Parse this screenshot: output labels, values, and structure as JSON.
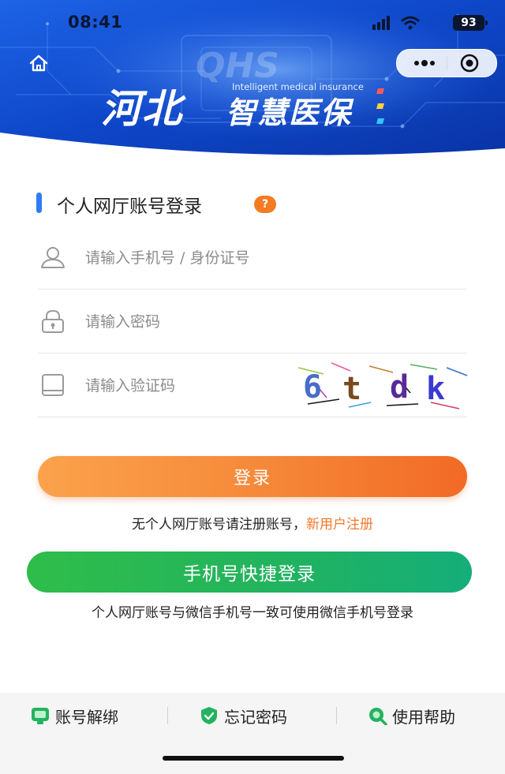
{
  "status_bar": {
    "time": "08:41",
    "battery": "93"
  },
  "nav": {
    "home_icon": "home-icon",
    "more_icon": "more-dots-icon",
    "close_icon": "target-close-icon"
  },
  "brand": {
    "title_main": "河北",
    "title_sub": "智慧医保",
    "tagline": "Intelligent medical insurance",
    "watermark": "QHS",
    "accent_colors": [
      "#ff5a5a",
      "#ffd23a",
      "#31c7ff"
    ]
  },
  "login": {
    "title": "个人网厅账号登录",
    "help_badge": "?",
    "account_placeholder": "请输入手机号 / 身份证号",
    "password_placeholder": "请输入密码",
    "captcha_placeholder": "请输入验证码",
    "captcha_chars": [
      "6",
      "t",
      "d",
      "k"
    ],
    "captcha_colors": [
      "#4a6cc9",
      "#7a4a1e",
      "#5a2a9a",
      "#3a3ad0"
    ],
    "login_button": "登录",
    "register_prompt": "无个人网厅账号请注册账号，",
    "register_link": "新用户注册",
    "phone_login_button": "手机号快捷登录",
    "phone_login_note": "个人网厅账号与微信手机号一致可使用微信手机号登录"
  },
  "footer": {
    "items": [
      {
        "label": "账号解绑",
        "icon": "unbind-icon",
        "color": "#22b35e"
      },
      {
        "label": "忘记密码",
        "icon": "shield-icon",
        "color": "#22b35e"
      },
      {
        "label": "使用帮助",
        "icon": "help-search-icon",
        "color": "#22b35e"
      }
    ]
  },
  "colors": {
    "primary_blue": "#2d7cf6",
    "login_orange": "#f58a3a",
    "phone_green": "#22b35e",
    "link_orange": "#f0782c"
  }
}
